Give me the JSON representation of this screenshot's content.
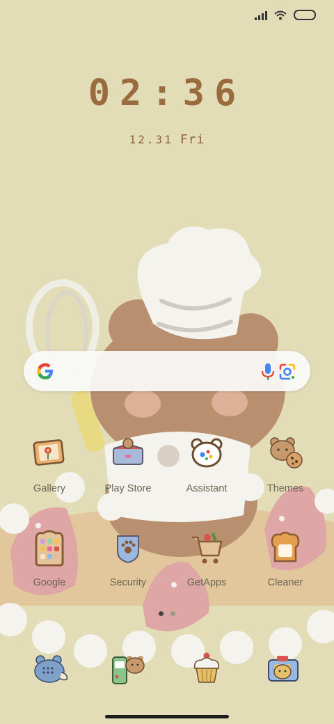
{
  "clock": {
    "time": "02:36",
    "date": "12.31",
    "day": "Fri"
  },
  "apps_row1": [
    {
      "label": "Gallery",
      "icon": "gallery-flower-frame-icon"
    },
    {
      "label": "Play Store",
      "icon": "play-store-bear-shop-icon"
    },
    {
      "label": "Assistant",
      "icon": "assistant-bear-icon"
    },
    {
      "label": "Themes",
      "icon": "themes-bear-cookie-icon"
    }
  ],
  "apps_row2": [
    {
      "label": "Google",
      "icon": "google-folder-toast-icon"
    },
    {
      "label": "Security",
      "icon": "security-paw-shield-icon"
    },
    {
      "label": "GetApps",
      "icon": "getapps-shopping-cart-icon"
    },
    {
      "label": "Cleaner",
      "icon": "cleaner-toast-icon"
    }
  ],
  "dock": [
    {
      "icon": "phone-bear-icon"
    },
    {
      "icon": "messages-bear-icon"
    },
    {
      "icon": "browser-cupcake-icon"
    },
    {
      "icon": "camera-bear-icon"
    }
  ],
  "colors": {
    "background": "#e3ddb7",
    "clock_text": "#9a6b3f",
    "label_text": "#6b6553",
    "active_page_dot": "#444444",
    "inactive_page_dot": "#9a9a8a"
  }
}
